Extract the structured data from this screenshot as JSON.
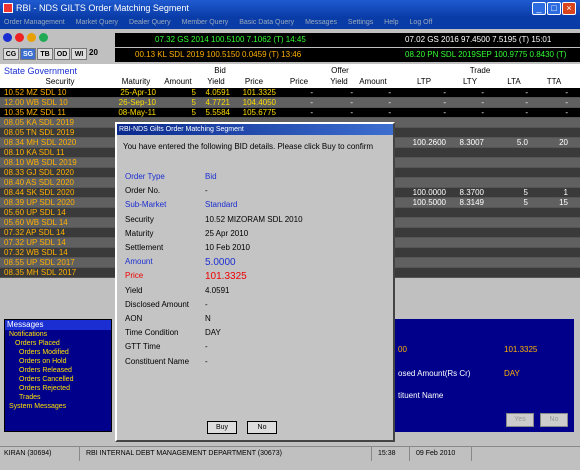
{
  "window": {
    "title": "RBI - NDS GILTS Order Matching Segment"
  },
  "menu": [
    "Order Management",
    "Market Query",
    "Dealer Query",
    "Member Query",
    "Basic Data Query",
    "Messages",
    "Settings",
    "Help",
    "Log Off"
  ],
  "ticker1": {
    "left": "07.32 GS 2014 100.5100 7.1062 (T) 14:45",
    "right": "07.02 GS 2016 97.4500 7.5195 (T) 15:01"
  },
  "ticker2": {
    "left": "00.13 KL SDL 2019 100.5150 0.0459 (T) 13:46",
    "right": "08.20 PN SDL 2019SEP 100.9775 0.8430 (T)"
  },
  "toolbar": {
    "tabs": [
      "CG",
      "SG",
      "TB",
      "OD",
      "WI"
    ],
    "wi_num": "20"
  },
  "grid": {
    "section": "State Government",
    "bid_header": "Bid",
    "offer_header": "Offer",
    "trade_header": "Trade",
    "cols": [
      "Security",
      "Maturity",
      "Amount",
      "Yield",
      "Price",
      "Price",
      "Yield",
      "Amount",
      "LTP",
      "LTY",
      "LTA",
      "TTA"
    ],
    "rows": [
      [
        "10.52 MZ SDL 10",
        "25-Apr-10",
        "5",
        "4.0591",
        "101.3325",
        "-",
        "-",
        "-",
        "-",
        "-",
        "-",
        "-"
      ],
      [
        "12.00 WB SDL 10",
        "26-Sep-10",
        "5",
        "4.7721",
        "104.4050",
        "-",
        "-",
        "-",
        "-",
        "-",
        "-",
        "-"
      ],
      [
        "10.35 MZ SDL 11",
        "08-May-11",
        "5",
        "5.5584",
        "105.6775",
        "-",
        "-",
        "-",
        "-",
        "-",
        "-",
        "-"
      ],
      [
        "08.05 KA SDL 2019",
        "",
        "",
        "",
        "",
        "",
        "",
        "",
        "",
        "",
        "",
        ""
      ],
      [
        "08.05 TN SDL 2019",
        "",
        "",
        "",
        "",
        "",
        "",
        "",
        "",
        "",
        "",
        ""
      ],
      [
        "08.34 MH SDL 2020",
        "",
        "",
        "",
        "",
        "",
        "",
        "",
        "100.2600",
        "8.3007",
        "5.0",
        "20"
      ],
      [
        "08.10 KA SDL 11",
        "",
        "",
        "",
        "",
        "",
        "",
        "",
        "",
        "",
        "",
        ""
      ],
      [
        "08.10 WB SDL 2019",
        "",
        "",
        "",
        "",
        "",
        "",
        "",
        "",
        "",
        "",
        ""
      ],
      [
        "08.33 GJ SDL 2020",
        "",
        "",
        "",
        "",
        "",
        "",
        "",
        "",
        "",
        "",
        ""
      ],
      [
        "08.40 AS SDL 2020",
        "",
        "",
        "",
        "",
        "",
        "",
        "",
        "",
        "",
        "",
        ""
      ],
      [
        "08.44 SK SDL 2020",
        "",
        "",
        "",
        "",
        "",
        "",
        "",
        "100.0000",
        "8.3700",
        "5",
        "1"
      ],
      [
        "08.39 UP SDL 2020",
        "",
        "",
        "",
        "",
        "",
        "",
        "",
        "100.5000",
        "8.3149",
        "5",
        "15"
      ],
      [
        "05.60 UP SDL 14",
        "",
        "",
        "",
        "",
        "",
        "",
        "",
        "",
        "",
        "",
        ""
      ],
      [
        "05.60 WB SDL 14",
        "",
        "",
        "",
        "",
        "",
        "",
        "",
        "",
        "",
        "",
        ""
      ],
      [
        "07.32 AP SDL 14",
        "",
        "",
        "",
        "",
        "",
        "",
        "",
        "",
        "",
        "",
        ""
      ],
      [
        "07.32 UP SDL 14",
        "",
        "",
        "",
        "",
        "",
        "",
        "",
        "",
        "",
        "",
        ""
      ],
      [
        "07.32 WB SDL 14",
        "",
        "",
        "",
        "",
        "",
        "",
        "",
        "",
        "",
        "",
        ""
      ],
      [
        "08.55 UP SDL 2017",
        "",
        "",
        "",
        "",
        "",
        "",
        "",
        "",
        "",
        "",
        ""
      ],
      [
        "08.35 MH SDL 2017",
        "",
        "",
        "",
        "",
        "",
        "",
        "",
        "",
        "",
        "",
        ""
      ]
    ]
  },
  "messages": {
    "title": "Messages",
    "items": [
      "Notifications",
      "Orders Placed",
      "Orders Modified",
      "Orders on Hold",
      "Orders Released",
      "Orders Cancelled",
      "Orders Rejected",
      "Trades",
      "System Messages"
    ]
  },
  "rightpanel": {
    "v1": "00",
    "v2": "101.3325",
    "lbl1": "osed Amount(Rs Cr)",
    "v3": "DAY",
    "lbl2": "tituent Name",
    "btn1": "Yes",
    "btn2": "No"
  },
  "dialog": {
    "title": "RBI-NDS Gilts Order Matching Segment",
    "message": "You have entered the following BID details. Please click Buy to confirm",
    "fields": [
      {
        "label": "Order Type",
        "value": "Bid"
      },
      {
        "label": "Order No.",
        "value": "-"
      },
      {
        "label": "Sub-Market",
        "value": "Standard"
      },
      {
        "label": "Security",
        "value": "10.52 MIZORAM SDL 2010"
      },
      {
        "label": "Maturity",
        "value": "25 Apr 2010"
      },
      {
        "label": "Settlement",
        "value": "10 Feb 2010"
      },
      {
        "label": "Amount",
        "value": "5.0000"
      },
      {
        "label": "Price",
        "value": "101.3325"
      },
      {
        "label": "Yield",
        "value": "4.0591"
      },
      {
        "label": "Disclosed Amount",
        "value": "-"
      },
      {
        "label": "AON",
        "value": "N"
      },
      {
        "label": "Time Condition",
        "value": "DAY"
      },
      {
        "label": "GTT Time",
        "value": "-"
      },
      {
        "label": "Constituent Name",
        "value": "-"
      }
    ],
    "buy_label": "Buy",
    "no_label": "No"
  },
  "status": {
    "user": "KIRAN (30694)",
    "dept": "RBI INTERNAL DEBT MANAGEMENT DEPARTMENT (30673)",
    "time": "15:38",
    "date": "09 Feb 2010"
  },
  "colors": {
    "title_blue": "#0a3ca8",
    "grid_bg": "#3a3a3a",
    "security_orange": "#ffb000",
    "ticker_green": "#33ff33"
  }
}
